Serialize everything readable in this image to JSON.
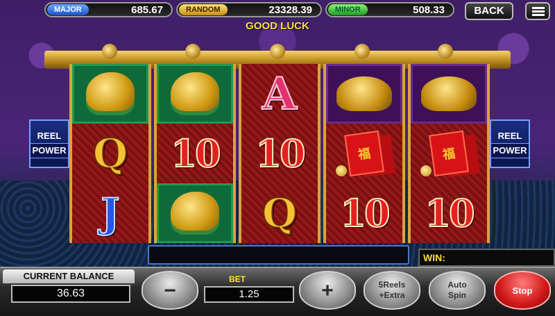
{
  "jackpots": {
    "major": {
      "label": "MAJOR",
      "value": "685.67"
    },
    "random": {
      "label": "RANDOM",
      "value": "23328.39"
    },
    "minor": {
      "label": "MINOR",
      "value": "508.33"
    }
  },
  "header": {
    "back_label": "BACK",
    "message": "GOOD LUCK"
  },
  "side_panel": {
    "line1": "REEL",
    "line2": "POWER"
  },
  "reels": [
    [
      "lion",
      "Q",
      "J"
    ],
    [
      "lion",
      "10",
      "lion"
    ],
    [
      "A",
      "10",
      "Q"
    ],
    [
      "turtle",
      "envelope",
      "10"
    ],
    [
      "turtle",
      "envelope",
      "10"
    ]
  ],
  "envelope_glyph": "福",
  "win": {
    "label": "WIN:"
  },
  "balance": {
    "label": "CURRENT BALANCE",
    "value": "36.63"
  },
  "bet": {
    "label": "BET",
    "value": "1.25",
    "minus": "−",
    "plus": "+"
  },
  "buttons": {
    "extra_line1": "5Reels",
    "extra_line2": "+Extra",
    "auto_line1": "Auto",
    "auto_line2": "Spin",
    "stop": "Stop"
  },
  "colors": {
    "accent_gold": "#d9a43a",
    "stop_red": "#d21818",
    "good_luck": "#ffe22a"
  }
}
